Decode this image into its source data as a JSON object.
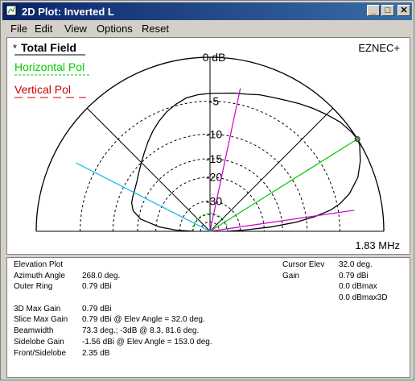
{
  "window": {
    "title": "2D Plot: Inverted L"
  },
  "menu": [
    "File",
    "Edit",
    "View",
    "Options",
    "Reset"
  ],
  "legend": {
    "total_marker": "*",
    "total": "Total Field",
    "horizontal": "Horizontal Pol",
    "vertical": "Vertical Pol"
  },
  "brand": "EZNEC+",
  "frequency": "1.83 MHz",
  "colors": {
    "total": "#000000",
    "horizontal": "#00cc00",
    "vertical": "#cc0000",
    "cursor_line": "#00cc00",
    "max_lines": "#cc00cc",
    "beamwidth_line": "#00bbee"
  },
  "chart_data": {
    "type": "polar",
    "ring_labels": [
      "0 dB",
      "-5",
      "-10",
      "-15",
      "-20",
      "-30"
    ],
    "ring_db": [
      0,
      -5,
      -10,
      -15,
      -20,
      -30
    ],
    "elevation_deg": [
      0,
      2,
      4,
      6,
      8,
      10,
      12,
      15,
      20,
      25,
      30,
      32,
      35,
      40,
      45,
      50,
      55,
      60,
      65,
      70,
      75,
      80,
      85,
      90,
      95,
      100,
      105,
      110,
      115,
      120,
      125,
      130,
      135,
      140,
      145,
      150,
      155,
      160,
      165,
      170,
      175,
      178,
      180
    ],
    "gain_db": [
      -40,
      -28,
      -18,
      -12,
      -8.5,
      -6,
      -4.6,
      -3.2,
      -1.7,
      -0.8,
      -0.1,
      0,
      -0.1,
      -0.4,
      -0.9,
      -1.4,
      -1.9,
      -2.4,
      -2.8,
      -3.1,
      -3.5,
      -3.7,
      -3.9,
      -4.0,
      -4.1,
      -4.3,
      -4.8,
      -5.4,
      -6.2,
      -7.1,
      -8.1,
      -9.1,
      -10.0,
      -10.8,
      -11.5,
      -12.0,
      -12.3,
      -12.6,
      -13.4,
      -15.5,
      -21,
      -28,
      -40
    ],
    "cursor_elev_deg": 32,
    "max_lines_deg": [
      78,
      8.3
    ],
    "beamwidth_line_deg": 153
  },
  "info": {
    "elevation_plot": "Elevation Plot",
    "azimuth_label": "Azimuth Angle",
    "azimuth_value": "268.0 deg.",
    "outer_ring_label": "Outer Ring",
    "outer_ring_value": "0.79 dBi",
    "max_gain_label": "3D Max Gain",
    "max_gain_value": "0.79 dBi",
    "slice_max_label": "Slice Max Gain",
    "slice_max_value": "0.79 dBi @ Elev Angle = 32.0 deg.",
    "beamwidth_label": "Beamwidth",
    "beamwidth_value": "73.3 deg.; -3dB @ 8.3, 81.6 deg.",
    "sidelobe_label": "Sidelobe Gain",
    "sidelobe_value": "-1.56 dBi @ Elev Angle = 153.0 deg.",
    "front_side_label": "Front/Sidelobe",
    "front_side_value": "2.35 dB",
    "cursor_elev_label": "Cursor Elev",
    "cursor_elev_value": "32.0 deg.",
    "gain_label": "Gain",
    "gain_value": "0.79 dBi",
    "dbmax": "0.0 dBmax",
    "dbmax3d": "0.0 dBmax3D"
  }
}
